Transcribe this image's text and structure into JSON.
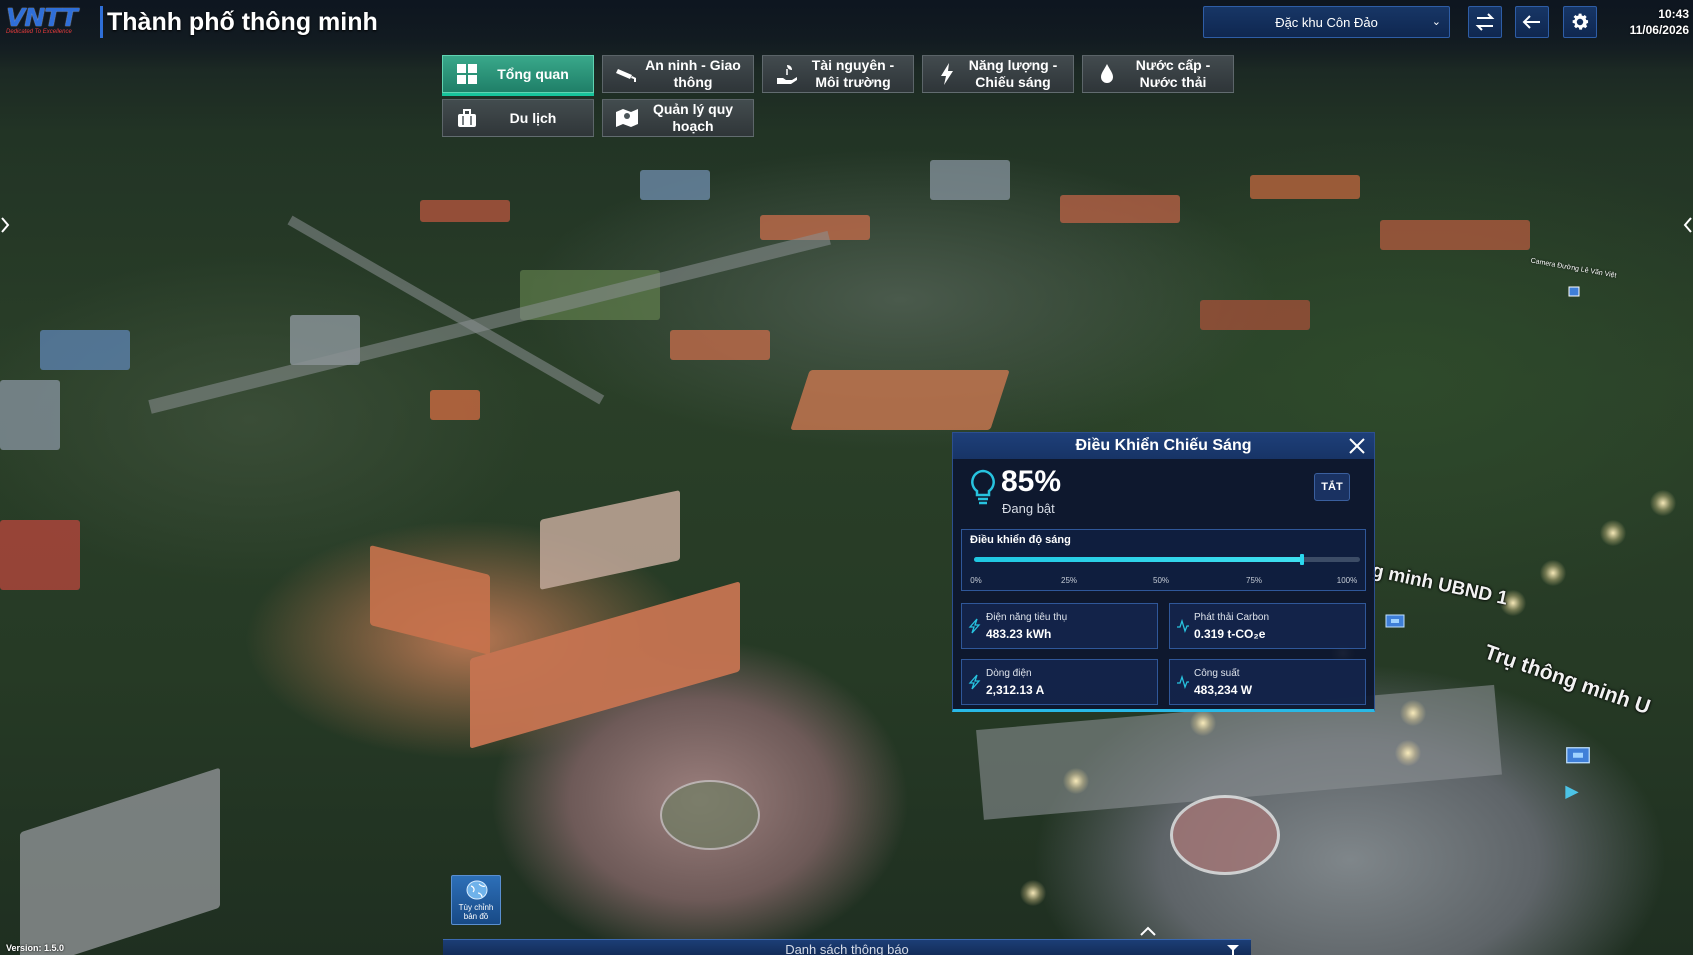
{
  "header": {
    "logo_text": "VNTT",
    "logo_tagline": "Dedicated To Excellence",
    "app_title": "Thành phố thông minh",
    "region": "Đặc khu Côn Đảo",
    "time": "10:43",
    "date": "11/06/2026"
  },
  "categories": [
    {
      "label": "Tổng quan",
      "icon": "grid-icon",
      "active": true
    },
    {
      "label": "An ninh - Giao thông",
      "icon": "cctv-icon",
      "active": false
    },
    {
      "label": "Tài nguyên - Môi trường",
      "icon": "hand-leaf-icon",
      "active": false
    },
    {
      "label": "Năng lượng - Chiếu sáng",
      "icon": "lightning-icon",
      "active": false
    },
    {
      "label": "Nước cấp - Nước thải",
      "icon": "water-drop-icon",
      "active": false
    },
    {
      "label": "Du lịch",
      "icon": "luggage-icon",
      "active": false
    },
    {
      "label": "Quản lý quy hoạch",
      "icon": "map-pin-icon",
      "active": false
    }
  ],
  "map_labels": {
    "ubnd": "g minh UBND 1",
    "tru": "Trụ thông minh U",
    "camera": "Camera Đường Lê Văn Việt"
  },
  "lighting_panel": {
    "title": "Điều Khiển Chiếu Sáng",
    "percent_text": "85%",
    "state": "Đang bật",
    "off_label": "TẮT",
    "brightness_title": "Điều khiển độ sáng",
    "brightness_fraction": 0.85,
    "ticks": [
      "0%",
      "25%",
      "50%",
      "75%",
      "100%"
    ],
    "metrics": [
      {
        "label": "Điện năng tiêu thụ",
        "value": "483.23 kWh",
        "icon": "lightning-icon"
      },
      {
        "label": "Phát thải Carbon",
        "value": "0.319 t-CO₂e",
        "icon": "pulse-icon"
      },
      {
        "label": "Dòng điện",
        "value": "2,312.13 A",
        "icon": "lightning-icon"
      },
      {
        "label": "Công suất",
        "value": "483,234 W",
        "icon": "pulse-icon"
      }
    ]
  },
  "bottom": {
    "basemap_tool_line1": "Tùy chỉnh",
    "basemap_tool_line2": "bản đồ",
    "notifications_label": "Danh sách thông báo",
    "version": "Version: 1.5.0"
  },
  "colors": {
    "accent_teal": "#39a88a",
    "panel_blue": "#0d162e",
    "slider_cyan": "#1fc7e2",
    "logo_blue": "#2f6fd8"
  }
}
